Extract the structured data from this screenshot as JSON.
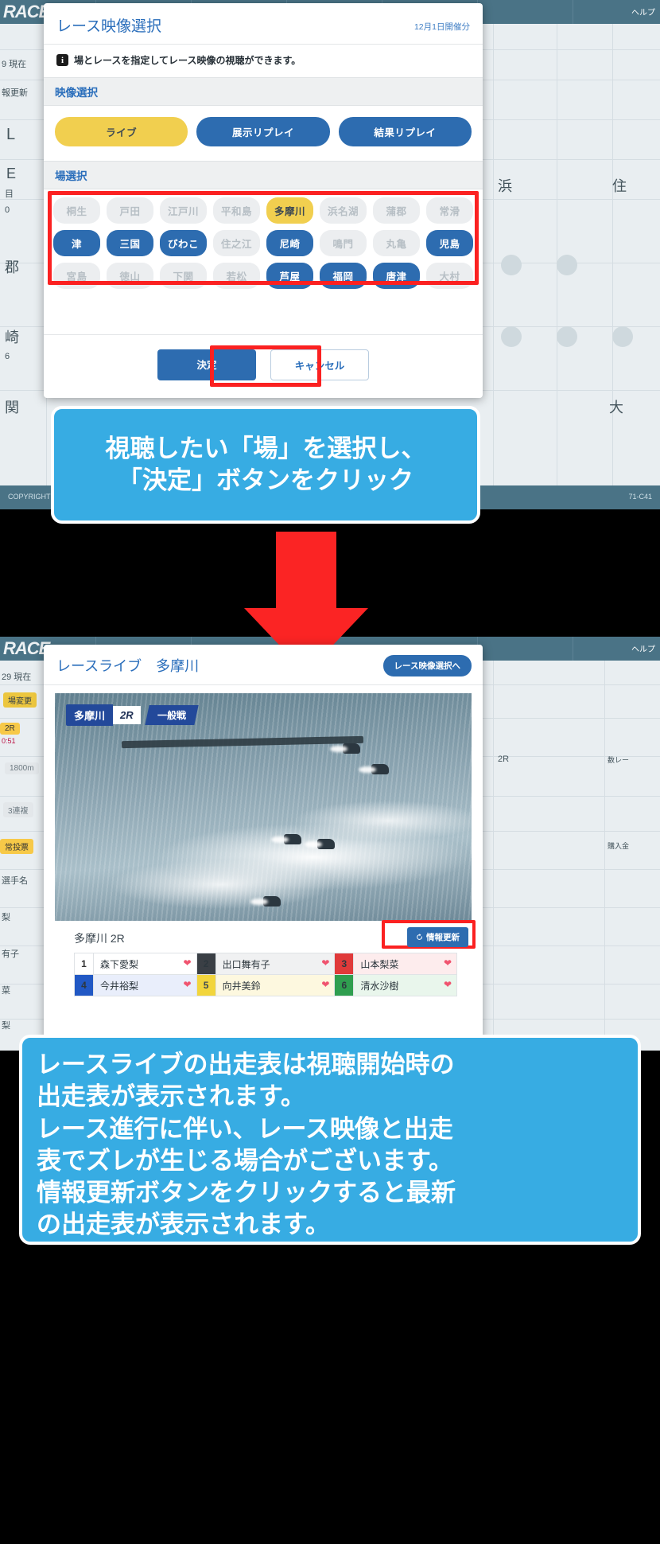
{
  "background_site": {
    "logo": "RACE",
    "help_label": "ヘルプ",
    "top_texts": [
      "9 現在",
      "報更新",
      "L",
      "E",
      "目",
      "0",
      "郡",
      "崎",
      "6",
      "関",
      "浜",
      "住",
      "大"
    ],
    "copyright": "COPYRIGHT",
    "code": "71-C41",
    "bottom_texts": [
      "29 現在",
      "場変更",
      "2R",
      "0:51",
      "1800m",
      "3連複",
      "常投票",
      "選手名",
      "梨",
      "有子",
      "菜",
      "梨",
      "2R",
      "数レー",
      "購入金"
    ]
  },
  "video_select_modal": {
    "title": "レース映像選択",
    "date_note": "12月1日開催分",
    "info_badge": "i",
    "info_text": "場とレースを指定してレース映像の視聴ができます。",
    "video_section_label": "映像選択",
    "video_modes": [
      {
        "label": "ライブ",
        "state": "selected"
      },
      {
        "label": "展示リプレイ",
        "state": "active"
      },
      {
        "label": "結果リプレイ",
        "state": "active"
      }
    ],
    "venue_section_label": "場選択",
    "venues": [
      [
        {
          "label": "桐生",
          "state": "off"
        },
        {
          "label": "戸田",
          "state": "off"
        },
        {
          "label": "江戸川",
          "state": "off"
        },
        {
          "label": "平和島",
          "state": "off"
        },
        {
          "label": "多摩川",
          "state": "cur"
        },
        {
          "label": "浜名湖",
          "state": "off"
        },
        {
          "label": "蒲郡",
          "state": "off"
        },
        {
          "label": "常滑",
          "state": "off"
        }
      ],
      [
        {
          "label": "津",
          "state": "on"
        },
        {
          "label": "三国",
          "state": "on"
        },
        {
          "label": "びわこ",
          "state": "on"
        },
        {
          "label": "住之江",
          "state": "off"
        },
        {
          "label": "尼崎",
          "state": "on"
        },
        {
          "label": "鳴門",
          "state": "off"
        },
        {
          "label": "丸亀",
          "state": "off"
        },
        {
          "label": "児島",
          "state": "on"
        }
      ],
      [
        {
          "label": "宮島",
          "state": "off"
        },
        {
          "label": "徳山",
          "state": "off"
        },
        {
          "label": "下関",
          "state": "off"
        },
        {
          "label": "若松",
          "state": "off"
        },
        {
          "label": "芦屋",
          "state": "on"
        },
        {
          "label": "福岡",
          "state": "on"
        },
        {
          "label": "唐津",
          "state": "on"
        },
        {
          "label": "大村",
          "state": "off"
        }
      ]
    ],
    "confirm_label": "決定",
    "cancel_label": "キャンセル"
  },
  "callout_select": {
    "line1": "視聴したい「場」を選択し、",
    "line2": "「決定」ボタンをクリック"
  },
  "race_live_modal": {
    "title": "レースライブ　多摩川",
    "to_select_label": "レース映像選択へ",
    "video_overlay": {
      "venue": "多摩川",
      "race": "2R",
      "grade": "一般戦"
    },
    "race_label": "多摩川 2R",
    "refresh_label": "情報更新",
    "refresh_icon": "refresh-icon",
    "entries": [
      {
        "num": "1",
        "name": "森下愛梨"
      },
      {
        "num": "2",
        "name": "出口舞有子"
      },
      {
        "num": "3",
        "name": "山本梨菜"
      },
      {
        "num": "4",
        "name": "今井裕梨"
      },
      {
        "num": "5",
        "name": "向井美鈴"
      },
      {
        "num": "6",
        "name": "清水沙樹"
      }
    ],
    "favorite_icon": "heart-icon"
  },
  "callout_live": {
    "line1": "レースライブの出走表は視聴開始時の",
    "line2": "出走表が表示されます。",
    "line3": "レース進行に伴い、レース映像と出走",
    "line4": "表でズレが生じる場合がございます。",
    "line5": "情報更新ボタンをクリックすると最新",
    "line6": "の出走表が表示されます。"
  },
  "colors": {
    "accent_blue": "#2d6cb0",
    "selected_yellow": "#f1cf4f",
    "highlight_red": "#fb2121",
    "callout_blue": "#37ace3"
  }
}
